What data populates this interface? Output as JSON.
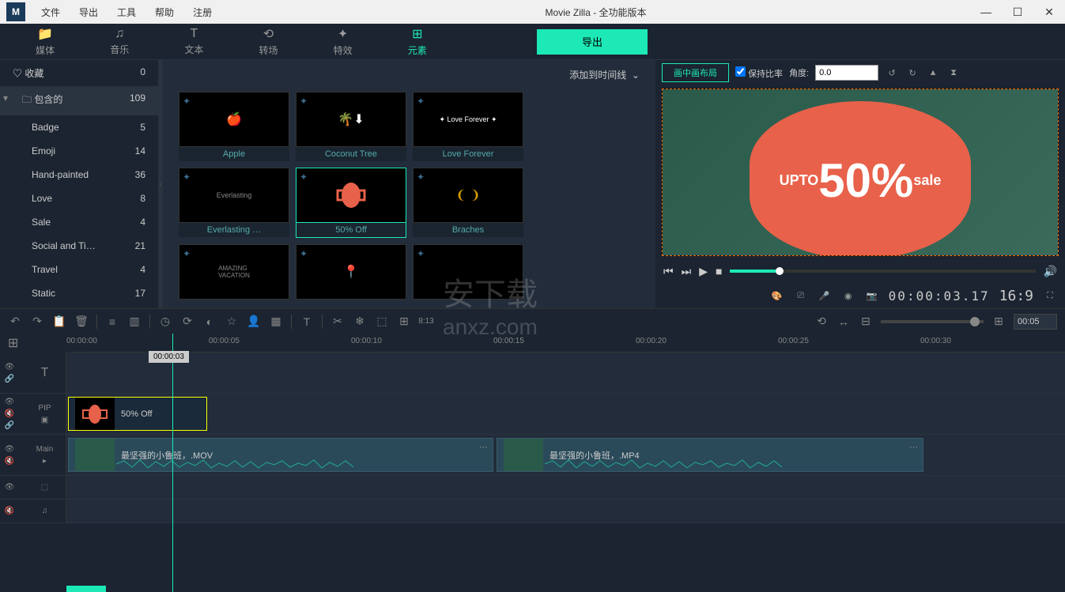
{
  "titlebar": {
    "app": "M",
    "menu": [
      "文件",
      "导出",
      "工具",
      "帮助",
      "注册"
    ],
    "title": "Movie Zilla  - 全功能版本"
  },
  "tabs": [
    {
      "icon": "📁",
      "label": "媒体"
    },
    {
      "icon": "♫",
      "label": "音乐"
    },
    {
      "icon": "T",
      "label": "文本"
    },
    {
      "icon": "⟲",
      "label": "转场"
    },
    {
      "icon": "✦",
      "label": "特效"
    },
    {
      "icon": "⊞",
      "label": "元素"
    }
  ],
  "export": "导出",
  "sidebar": {
    "fav": {
      "label": "收藏",
      "count": "0"
    },
    "inc": {
      "label": "包含的",
      "count": "109"
    },
    "items": [
      {
        "label": "Badge",
        "count": "5"
      },
      {
        "label": "Emoji",
        "count": "14"
      },
      {
        "label": "Hand-painted",
        "count": "36"
      },
      {
        "label": "Love",
        "count": "8"
      },
      {
        "label": "Sale",
        "count": "4"
      },
      {
        "label": "Social and Ti…",
        "count": "21"
      },
      {
        "label": "Travel",
        "count": "4"
      },
      {
        "label": "Static",
        "count": "17"
      }
    ]
  },
  "addTimeline": "添加到时间线",
  "cards": [
    {
      "label": "Apple"
    },
    {
      "label": "Coconut Tree"
    },
    {
      "label": "Love Forever"
    },
    {
      "label": "Everlasting …"
    },
    {
      "label": "50% Off"
    },
    {
      "label": "Braches"
    },
    {
      "label": ""
    },
    {
      "label": ""
    },
    {
      "label": ""
    }
  ],
  "preview": {
    "layout": "画中画布局",
    "keepRatio": "保持比率",
    "angle": "角度:",
    "angleVal": "0.0",
    "badge": {
      "upto": "UPTO",
      "pct": "50%",
      "sale": "sale"
    },
    "time": "00:00:03.17",
    "aspect": "16:9"
  },
  "tlToolbar": {
    "ratio": "8:13"
  },
  "tlZoom": {
    "time": "00:05"
  },
  "ruler": [
    "00:00:00",
    "00:00:05",
    "00:00:10",
    "00:00:15",
    "00:00:20",
    "00:00:25",
    "00:00:30"
  ],
  "playhead": "00:00:03",
  "tracks": {
    "text": {
      "label": "T"
    },
    "pip": {
      "label": "PIP",
      "clip": "50% Off"
    },
    "main": {
      "label": "Main",
      "clip1": "最坚强的小鲁班，.MOV",
      "clip2": "最坚强的小鲁班，.MP4"
    }
  },
  "watermark": {
    "top": "安下载",
    "bottom": "anxz.com"
  }
}
